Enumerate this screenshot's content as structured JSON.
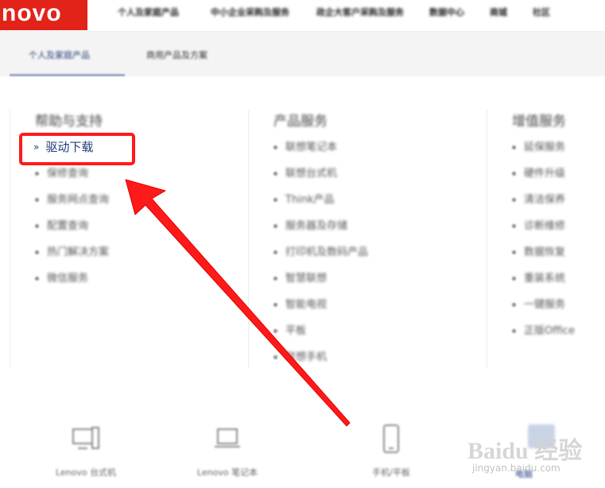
{
  "header": {
    "logo_text": "novo",
    "nav_items": [
      "个人及家庭产品",
      "中小企业采购及服务",
      "政企大客户采购及服务",
      "数据中心",
      "商城",
      "社区"
    ]
  },
  "subnav": {
    "tabs": [
      "个人及家庭产品",
      "商用产品及方案"
    ]
  },
  "columns": [
    {
      "title": "帮助与支持",
      "items": [
        "驱动下载",
        "保修查询",
        "服务网点查询",
        "配置查询",
        "热门解决方案",
        "微信服务"
      ]
    },
    {
      "title": "产品服务",
      "items": [
        "联想笔记本",
        "联想台式机",
        "Think产品",
        "服务器及存储",
        "打印机及数码产品",
        "智慧联想",
        "智能电视",
        "平板",
        "联想手机"
      ]
    },
    {
      "title": "增值服务",
      "items": [
        "延保服务",
        "硬件升级",
        "清洁保养",
        "诊断维修",
        "数据恢复",
        "重装系统",
        "一键服务",
        "正版Office"
      ]
    }
  ],
  "highlight": {
    "chevron": "»",
    "label": "驱动下载",
    "box_color": "#ff1a1a"
  },
  "products": [
    {
      "label": "Lenovo 台式机",
      "icon": "desktop-icon"
    },
    {
      "label": "Lenovo 笔记本",
      "icon": "laptop-icon"
    },
    {
      "label": "手机/平板",
      "icon": "phone-icon"
    }
  ],
  "right_partial_label": "电脑",
  "watermark": {
    "main": "Baidu 经验",
    "sub": "jingyan.baidu.com"
  },
  "colors": {
    "brand_red": "#e2231a",
    "annotation_red": "#ff1a1a",
    "link_blue": "#1f3b7a"
  }
}
